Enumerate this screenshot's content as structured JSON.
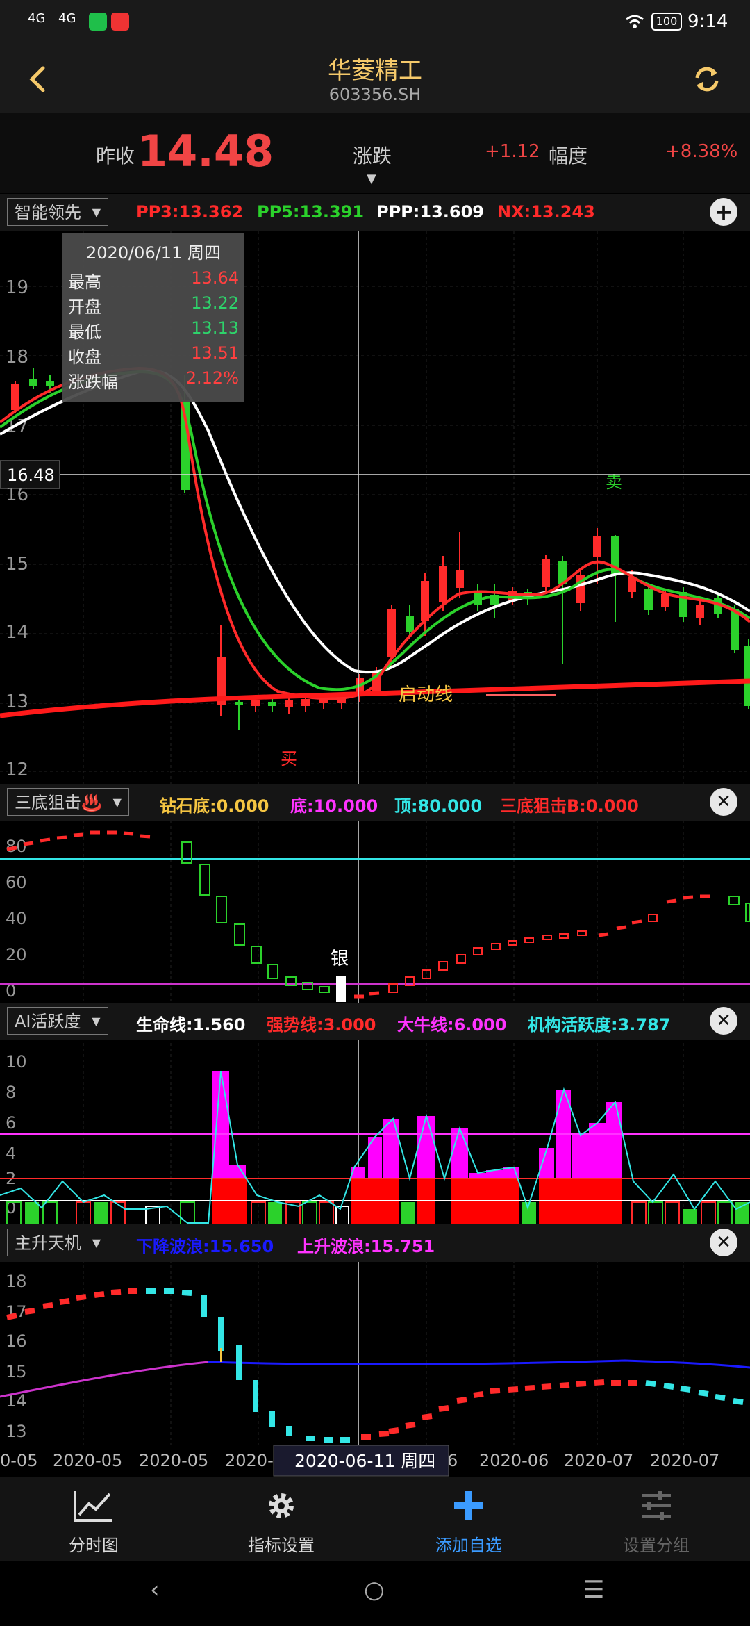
{
  "status_bar": {
    "network1": "4G",
    "network2": "4G",
    "battery": "100",
    "time": "9:14"
  },
  "header": {
    "stock_name": "华菱精工",
    "stock_code": "603356.SH"
  },
  "quote": {
    "prev_close_label": "昨收",
    "price": "14.48",
    "change_label": "涨跌",
    "change_value": "+1.12",
    "amplitude_label": "幅度",
    "amplitude_value": "+8.38%"
  },
  "main_indicator": {
    "selector": "智能领先",
    "values": [
      {
        "text": "PP3:13.362",
        "color": "#ff2a2a"
      },
      {
        "text": "PP5:13.391",
        "color": "#2bd12b"
      },
      {
        "text": "PPP:13.609",
        "color": "#ffffff"
      },
      {
        "text": "NX:13.243",
        "color": "#ff2a2a"
      }
    ]
  },
  "tooltip": {
    "date": "2020/06/11 周四",
    "rows": [
      {
        "label": "最高",
        "value": "13.64",
        "color": "#ff4040"
      },
      {
        "label": "开盘",
        "value": "13.22",
        "color": "#2ed36b"
      },
      {
        "label": "最低",
        "value": "13.13",
        "color": "#2ed36b"
      },
      {
        "label": "收盘",
        "value": "13.51",
        "color": "#ff4040"
      },
      {
        "label": "涨跌幅",
        "value": "2.12%",
        "color": "#ff4040"
      }
    ]
  },
  "main_chart": {
    "y_ticks": [
      "19",
      "18",
      "17",
      "16",
      "15",
      "14",
      "13",
      "12"
    ],
    "crosshair_value": "16.48",
    "buy_label": "买",
    "sell_label": "卖",
    "launch_label": "启动线"
  },
  "panel2": {
    "selector": "三底狙击♨️",
    "values": [
      {
        "text": "钻石底:0.000",
        "color": "#f5c542"
      },
      {
        "text": "底:10.000",
        "color": "#ff33ff"
      },
      {
        "text": "顶:80.000",
        "color": "#33e6e6"
      },
      {
        "text": "三底狙击B:0.000",
        "color": "#ff2a2a"
      }
    ],
    "y_ticks": [
      "80",
      "60",
      "40",
      "20",
      "0"
    ],
    "silver_label": "银"
  },
  "panel3": {
    "selector": "AI活跃度",
    "values": [
      {
        "text": "生命线:1.560",
        "color": "#ffffff"
      },
      {
        "text": "强势线:3.000",
        "color": "#ff2a2a"
      },
      {
        "text": "大牛线:6.000",
        "color": "#ff33ff"
      },
      {
        "text": "机构活跃度:3.787",
        "color": "#33e6e6"
      }
    ],
    "y_ticks": [
      "10",
      "8",
      "6",
      "4",
      "2",
      "0"
    ]
  },
  "panel4": {
    "selector": "主升天机",
    "values": [
      {
        "text": "下降波浪:15.650",
        "color": "#1a1aff"
      },
      {
        "text": "上升波浪:15.751",
        "color": "#ff33ff"
      }
    ],
    "y_ticks": [
      "18",
      "17",
      "16",
      "15",
      "14",
      "13"
    ]
  },
  "x_axis": {
    "labels": [
      "0-05",
      "2020-05",
      "2020-05",
      "2020-0",
      "6",
      "2020-06",
      "2020-07",
      "2020-07"
    ],
    "crosshair_date": "2020-06-11 周四"
  },
  "bottom_nav": [
    {
      "label": "分时图",
      "icon": "line-chart-icon",
      "color": "#dddddd"
    },
    {
      "label": "指标设置",
      "icon": "gear-icon",
      "color": "#dddddd"
    },
    {
      "label": "添加自选",
      "icon": "plus-icon",
      "color": "#3b9bff"
    },
    {
      "label": "设置分组",
      "icon": "sliders-icon",
      "color": "#666666"
    }
  ],
  "colors": {
    "up": "#ff2a2a",
    "down": "#2bd12b",
    "accent": "#f5c96a",
    "magenta": "#ff00ff",
    "cyan": "#33e6e6"
  }
}
